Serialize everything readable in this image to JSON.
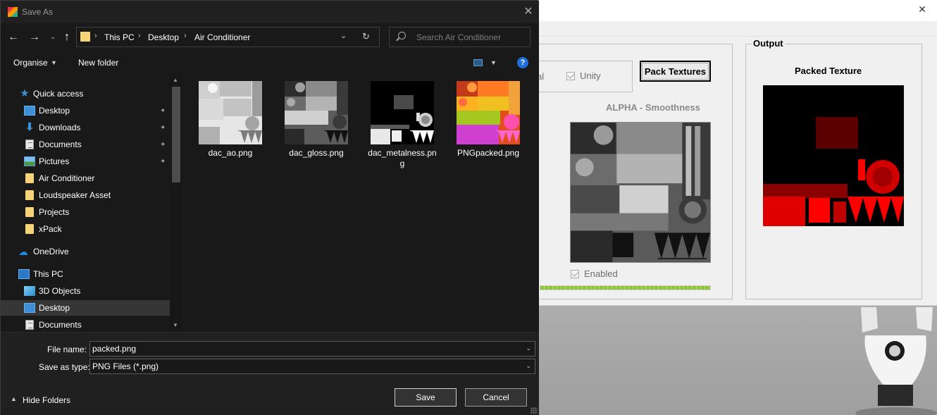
{
  "dialog": {
    "title": "Save As",
    "address": {
      "crumbs": [
        "This PC",
        "Desktop",
        "Air Conditioner"
      ]
    },
    "search_placeholder": "Search Air Conditioner",
    "toolbar": {
      "organise": "Organise",
      "new_folder": "New folder",
      "help": "?"
    },
    "nav": {
      "items": [
        {
          "label": "Quick access",
          "icon": "star-icon",
          "pinned": false
        },
        {
          "label": "Desktop",
          "icon": "desktop-icon",
          "pinned": true
        },
        {
          "label": "Downloads",
          "icon": "download-icon",
          "pinned": true
        },
        {
          "label": "Documents",
          "icon": "document-icon",
          "pinned": true
        },
        {
          "label": "Pictures",
          "icon": "pictures-icon",
          "pinned": true
        },
        {
          "label": "Air Conditioner",
          "icon": "folder-icon",
          "pinned": false
        },
        {
          "label": "Loudspeaker Asset",
          "icon": "folder-icon",
          "pinned": false
        },
        {
          "label": "Projects",
          "icon": "folder-icon",
          "pinned": false
        },
        {
          "label": "xPack",
          "icon": "folder-icon",
          "pinned": false
        },
        {
          "label": "OneDrive",
          "icon": "cloud-icon",
          "pinned": false
        },
        {
          "label": "This PC",
          "icon": "computer-icon",
          "pinned": false
        },
        {
          "label": "3D Objects",
          "icon": "cube-icon",
          "pinned": false
        },
        {
          "label": "Desktop",
          "icon": "desktop-icon",
          "pinned": false,
          "selected": true
        },
        {
          "label": "Documents",
          "icon": "document-icon",
          "pinned": false
        }
      ]
    },
    "files": [
      {
        "name": "dac_ao.png"
      },
      {
        "name": "dac_gloss.png"
      },
      {
        "name": "dac_metalness.png"
      },
      {
        "name": "PNGpacked.png"
      }
    ],
    "file_name_label": "File name:",
    "file_name_value": "packed.png",
    "save_type_label": "Save as type:",
    "save_type_value": "PNG Files (*.png)",
    "save_label": "Save",
    "cancel_label": "Cancel",
    "hide_folders_label": "Hide Folders"
  },
  "app": {
    "engine_partial": "al",
    "unity_label": "Unity",
    "pack_button": "Pack Textures",
    "alpha_label": "ALPHA - Smoothness",
    "enabled_label": "Enabled",
    "output_legend": "Output",
    "packed_title": "Packed Texture",
    "progress_fraction": 1.0,
    "colors": {
      "progress": "#8fc33a",
      "packed_accent": "#ff0000"
    }
  }
}
